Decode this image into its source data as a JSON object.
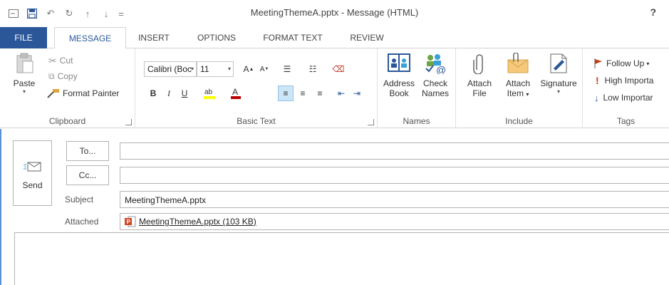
{
  "titlebar": {
    "title": "MeetingThemeA.pptx - Message (HTML)",
    "help": "?"
  },
  "tabs": [
    "FILE",
    "MESSAGE",
    "INSERT",
    "OPTIONS",
    "FORMAT TEXT",
    "REVIEW"
  ],
  "clipboard": {
    "paste": "Paste",
    "cut": "Cut",
    "copy": "Copy",
    "format_painter": "Format Painter",
    "label": "Clipboard"
  },
  "basic_text": {
    "font": "Calibri (Boc",
    "size": "11",
    "label": "Basic Text"
  },
  "names": {
    "address_book_1": "Address",
    "address_book_2": "Book",
    "check_names_1": "Check",
    "check_names_2": "Names",
    "label": "Names"
  },
  "include": {
    "attach_file_1": "Attach",
    "attach_file_2": "File",
    "attach_item_1": "Attach",
    "attach_item_2": "Item",
    "signature": "Signature",
    "label": "Include"
  },
  "tags": {
    "follow_up": "Follow Up",
    "high_importance": "High Importa",
    "low_importance": "Low Importar",
    "label": "Tags"
  },
  "compose": {
    "send": "Send",
    "to": "To...",
    "cc": "Cc...",
    "subject_label": "Subject",
    "subject_value": "MeetingThemeA.pptx",
    "attached_label": "Attached",
    "attachment": "MeetingThemeA.pptx (103 KB)"
  },
  "colors": {
    "file_tab": "#2b579a",
    "accent": "#2b579a",
    "follow_up_flag": "#c43e1c",
    "high_importance": "#c43e1c",
    "low_importance": "#2b579a"
  }
}
